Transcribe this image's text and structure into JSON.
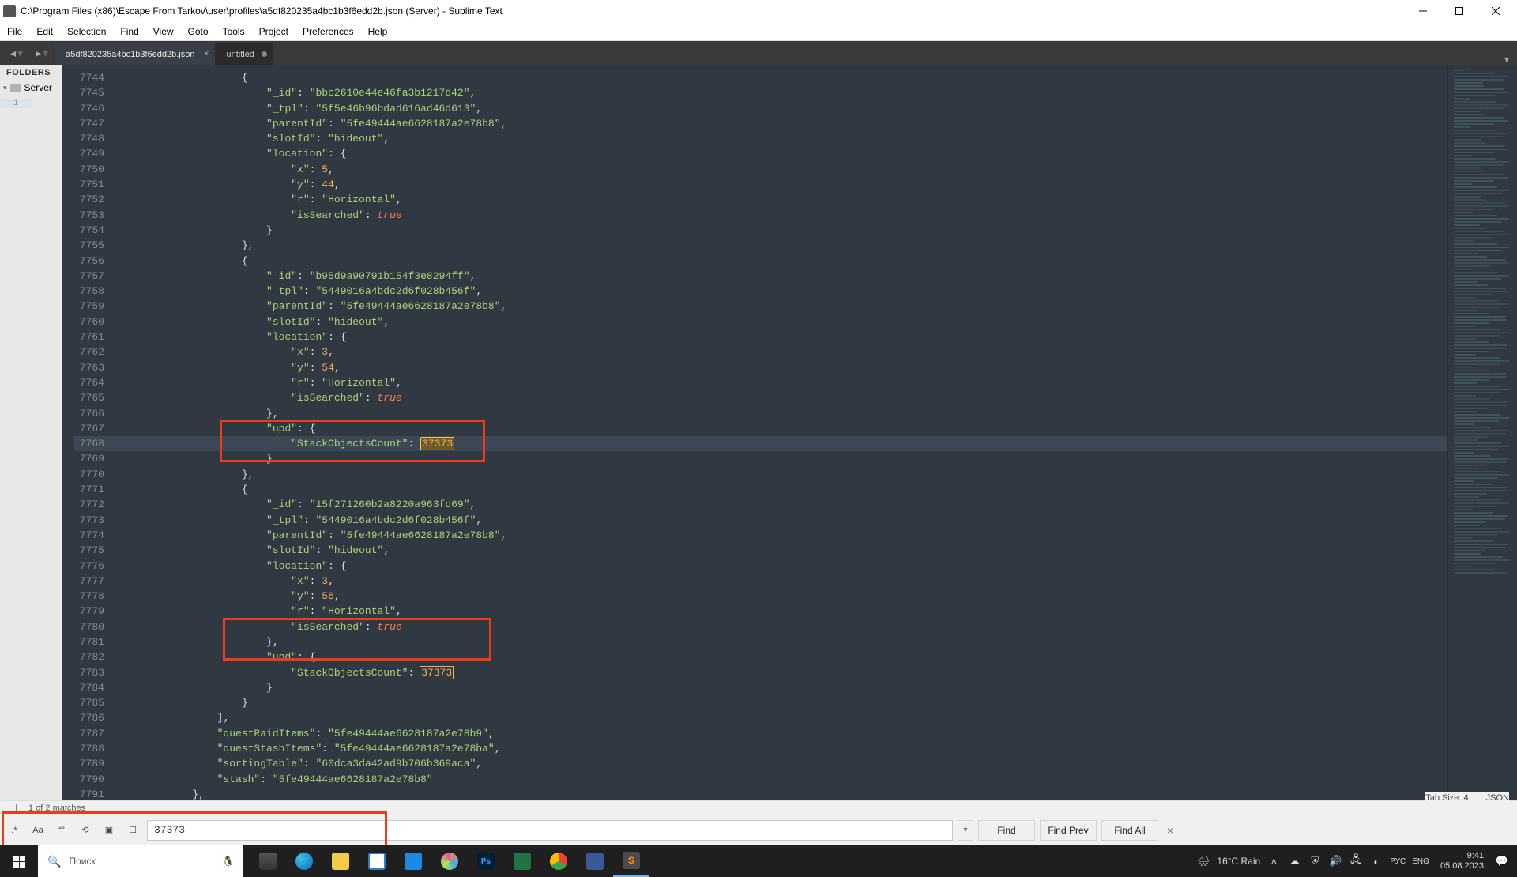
{
  "title": "C:\\Program Files (x86)\\Escape From Tarkov\\user\\profiles\\a5df820235a4bc1b3f6edd2b.json (Server) - Sublime Text",
  "menu": [
    "File",
    "Edit",
    "Selection",
    "Find",
    "View",
    "Goto",
    "Tools",
    "Project",
    "Preferences",
    "Help"
  ],
  "folders": {
    "title": "FOLDERS",
    "root": "Server"
  },
  "tabs": [
    {
      "label": "a5df820235a4bc1b3f6edd2b.json",
      "active": true,
      "dirty": false
    },
    {
      "label": "untitled",
      "active": false,
      "dirty": true
    }
  ],
  "lineStart": 7744,
  "lineEnd": 7791,
  "hlLine": 7768,
  "sideLine": "1",
  "leftPad": 58,
  "code": [
    "            {",
    "                \"_id\": \"bbc2610e44e46fa3b1217d42\",",
    "                \"_tpl\": \"5f5e46b96bdad616ad46d613\",",
    "                \"parentId\": \"5fe49444ae6628187a2e78b8\",",
    "                \"slotId\": \"hideout\",",
    "                \"location\": {",
    "                    \"x\": 5,",
    "                    \"y\": 44,",
    "                    \"r\": \"Horizontal\",",
    "                    \"isSearched\": true",
    "                }",
    "            },",
    "            {",
    "                \"_id\": \"b95d9a90791b154f3e8294ff\",",
    "                \"_tpl\": \"5449016a4bdc2d6f028b456f\",",
    "                \"parentId\": \"5fe49444ae6628187a2e78b8\",",
    "                \"slotId\": \"hideout\",",
    "                \"location\": {",
    "                    \"x\": 3,",
    "                    \"y\": 54,",
    "                    \"r\": \"Horizontal\",",
    "                    \"isSearched\": true",
    "                },",
    "                \"upd\": {",
    "                    \"StackObjectsCount\": 37373",
    "                }",
    "            },",
    "            {",
    "                \"_id\": \"15f271260b2a8220a963fd69\",",
    "                \"_tpl\": \"5449016a4bdc2d6f028b456f\",",
    "                \"parentId\": \"5fe49444ae6628187a2e78b8\",",
    "                \"slotId\": \"hideout\",",
    "                \"location\": {",
    "                    \"x\": 3,",
    "                    \"y\": 56,",
    "                    \"r\": \"Horizontal\",",
    "                    \"isSearched\": true",
    "                },",
    "                \"upd\": {",
    "                    \"StackObjectsCount\": 37373",
    "                }",
    "            }",
    "        ],",
    "        \"questRaidItems\": \"5fe49444ae6628187a2e78b9\",",
    "        \"questStashItems\": \"5fe49444ae6628187a2e78ba\",",
    "        \"sortingTable\": \"60dca3da42ad9b706b369aca\",",
    "        \"stash\": \"5fe49444ae6628187a2e78b8\"",
    "    },"
  ],
  "find": {
    "input": "37373",
    "status": "1 of 2 matches",
    "buttons": {
      "find": "Find",
      "prev": "Find Prev",
      "all": "Find All"
    },
    "dropdown": "▾",
    "opts": {
      "regex": ".*",
      "case": "Aa",
      "word": "“”",
      "wrap": "⟲",
      "insel": "▣",
      "highlight": "☐"
    }
  },
  "status": {
    "tabsize": "Tab Size: 4",
    "syntax": "JSON"
  },
  "taskbar": {
    "search": "Поиск",
    "weather": "16°C  Rain",
    "lang1": "РУС",
    "lang2": "ENG",
    "time": "9:41",
    "date": "05.08.2023"
  }
}
